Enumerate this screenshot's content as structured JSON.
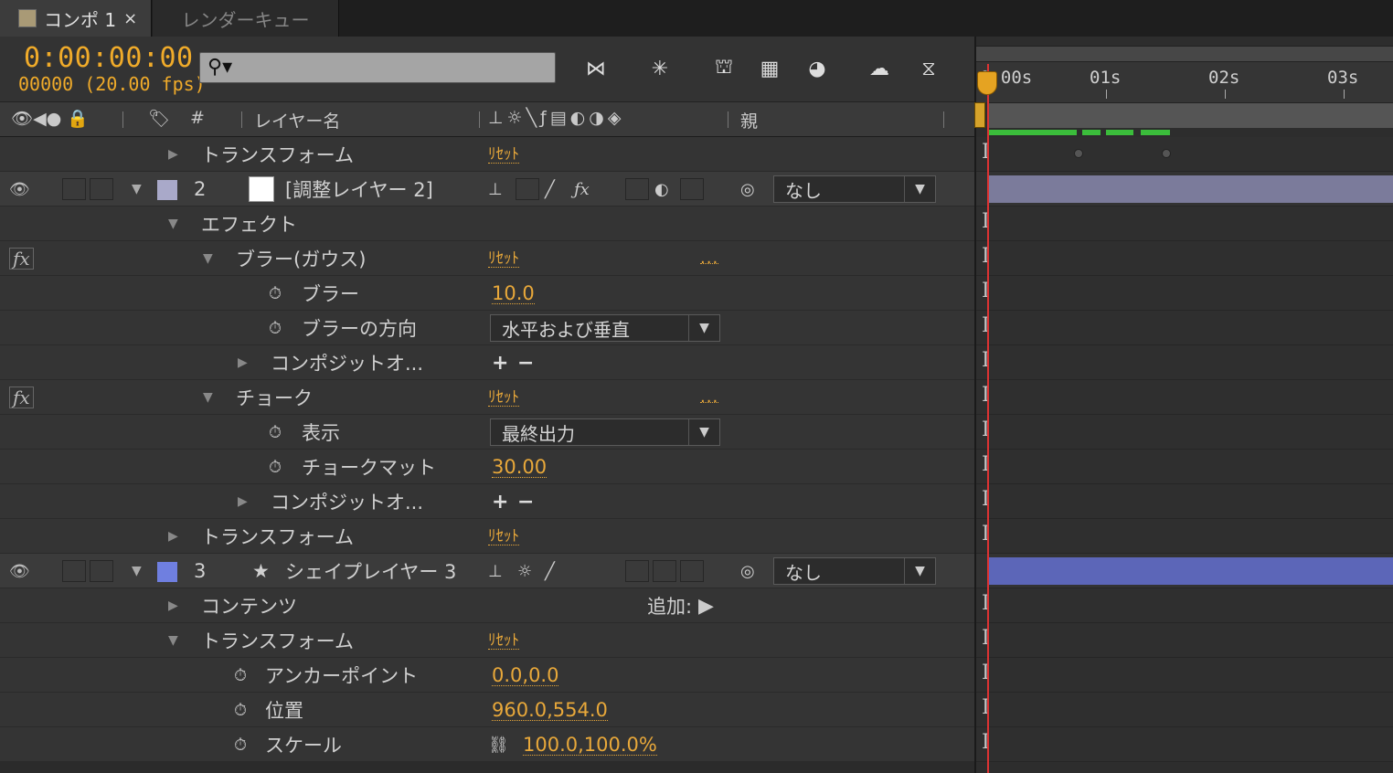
{
  "tabs": {
    "comp": {
      "label": "コンポ 1",
      "close": "×",
      "swatch_color": "#a99a76"
    },
    "render": {
      "label": "レンダーキュー"
    }
  },
  "toolbar": {
    "timecode": "0:00:00:00",
    "frame_info": "00000 (20.00 fps)",
    "search_placeholder": "",
    "search_icon": "search-icon",
    "icons": [
      "mini-flowchart-icon",
      "draft-3d-icon",
      "shy-layers-icon",
      "frame-blending-icon",
      "motion-blur-icon",
      "brainstorm-icon",
      "graph-editor-icon"
    ]
  },
  "columns": {
    "number": "#",
    "layer_name": "レイヤー名",
    "parent": "親"
  },
  "rows": [
    {
      "type": "prop",
      "label": "トランスフォーム",
      "reset": "ﾘｾｯﾄ"
    },
    {
      "type": "layer",
      "index": "2",
      "name": "[調整レイヤー 2]",
      "label_color": "#a9a9c9",
      "thumb_color": "#ffffff",
      "parent": "なし"
    },
    {
      "type": "group",
      "label": "エフェクト"
    },
    {
      "type": "effect",
      "label": "ブラー(ガウス)",
      "reset": "ﾘｾｯﾄ",
      "dots": "..."
    },
    {
      "type": "param",
      "label": "ブラー",
      "value": "10.0"
    },
    {
      "type": "param-dd",
      "label": "ブラーの方向",
      "value": "水平および垂直"
    },
    {
      "type": "composite",
      "label": "コンポジットオ...",
      "plus": "+",
      "minus": "−"
    },
    {
      "type": "effect",
      "label": "チョーク",
      "reset": "ﾘｾｯﾄ",
      "dots": "..."
    },
    {
      "type": "param-dd",
      "label": "表示",
      "value": "最終出力"
    },
    {
      "type": "param",
      "label": "チョークマット",
      "value": "30.00"
    },
    {
      "type": "composite",
      "label": "コンポジットオ...",
      "plus": "+",
      "minus": "−"
    },
    {
      "type": "prop",
      "label": "トランスフォーム",
      "reset": "ﾘｾｯﾄ"
    },
    {
      "type": "layer",
      "index": "3",
      "name": "シェイプレイヤー 3",
      "label_color": "#6f7fe0",
      "parent": "なし"
    },
    {
      "type": "prop",
      "label": "コンテンツ",
      "add": "追加:"
    },
    {
      "type": "prop-open",
      "label": "トランスフォーム",
      "reset": "ﾘｾｯﾄ"
    },
    {
      "type": "tparam",
      "label": "アンカーポイント",
      "value": "0.0,0.0"
    },
    {
      "type": "tparam",
      "label": "位置",
      "value": "960.0,554.0"
    },
    {
      "type": "tparam",
      "label": "スケール",
      "value": "100.0,100.0%"
    }
  ],
  "timeline": {
    "ticks": [
      "0:00s",
      "01s",
      "02s",
      "03s"
    ],
    "layer2_bar_color": "#7b7b9b",
    "layer3_bar_color": "#5c66b8",
    "playhead_color": "#dd3333"
  }
}
